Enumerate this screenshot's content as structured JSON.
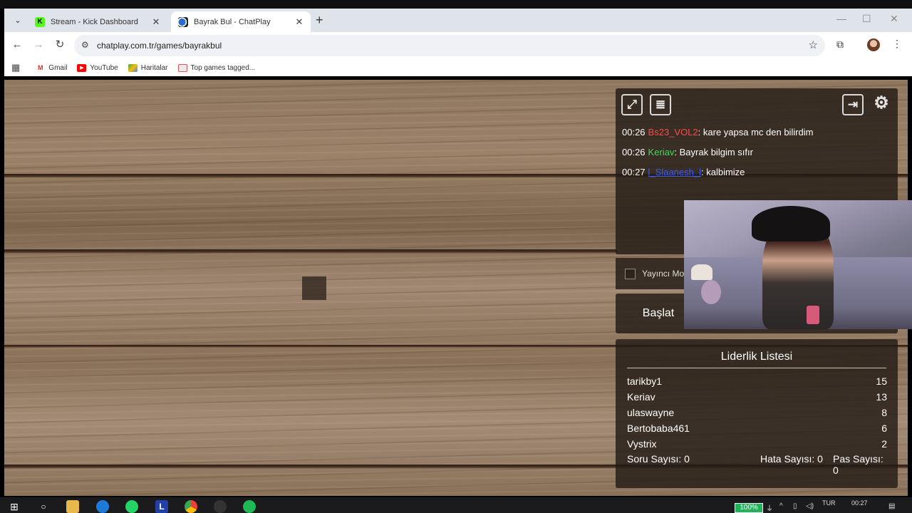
{
  "browser": {
    "tabs": [
      {
        "label": "Stream - Kick Dashboard",
        "icon": "kick-icon",
        "active": false
      },
      {
        "label": "Bayrak Bul - ChatPlay",
        "icon": "chatplay-icon",
        "active": true
      }
    ],
    "url": "chatplay.com.tr/games/bayrakbul",
    "bookmarks": [
      {
        "label": "Gmail",
        "icon": "gmail-icon"
      },
      {
        "label": "YouTube",
        "icon": "youtube-icon"
      },
      {
        "label": "Haritalar",
        "icon": "maps-icon"
      },
      {
        "label": "Top games tagged...",
        "icon": "bookmark-icon"
      }
    ]
  },
  "chat": {
    "messages": [
      {
        "time": "00:26",
        "user": "Bs23_VOL2",
        "user_color": "#ff4a4a",
        "text": ": kare yapsa mc den bilirdim"
      },
      {
        "time": "00:26",
        "user": "Keriav",
        "user_color": "#3ddc5a",
        "text": ": Bayrak bilgim sıfır"
      },
      {
        "time": "00:27",
        "user": "l_Slaanesh_l",
        "user_color": "#3d5cff",
        "text": ": kalbimize"
      }
    ]
  },
  "controls": {
    "streamer_mode_label": "Yayıncı Mo",
    "start_label": "Başlat"
  },
  "leaderboard": {
    "title": "Liderlik Listesi",
    "rows": [
      {
        "name": "tarikby1",
        "score": "15"
      },
      {
        "name": "Keriav",
        "score": "13"
      },
      {
        "name": "ulaswayne",
        "score": "8"
      },
      {
        "name": "Bertobaba461",
        "score": "6"
      },
      {
        "name": "Vystrix",
        "score": "2"
      }
    ],
    "question_count": "Soru Sayısı: 0",
    "error_count": "Hata Sayısı: 0",
    "pass_count": "Pas Sayısı: 0"
  },
  "taskbar": {
    "battery": "100%",
    "language": "TUR",
    "time": "00:27"
  }
}
